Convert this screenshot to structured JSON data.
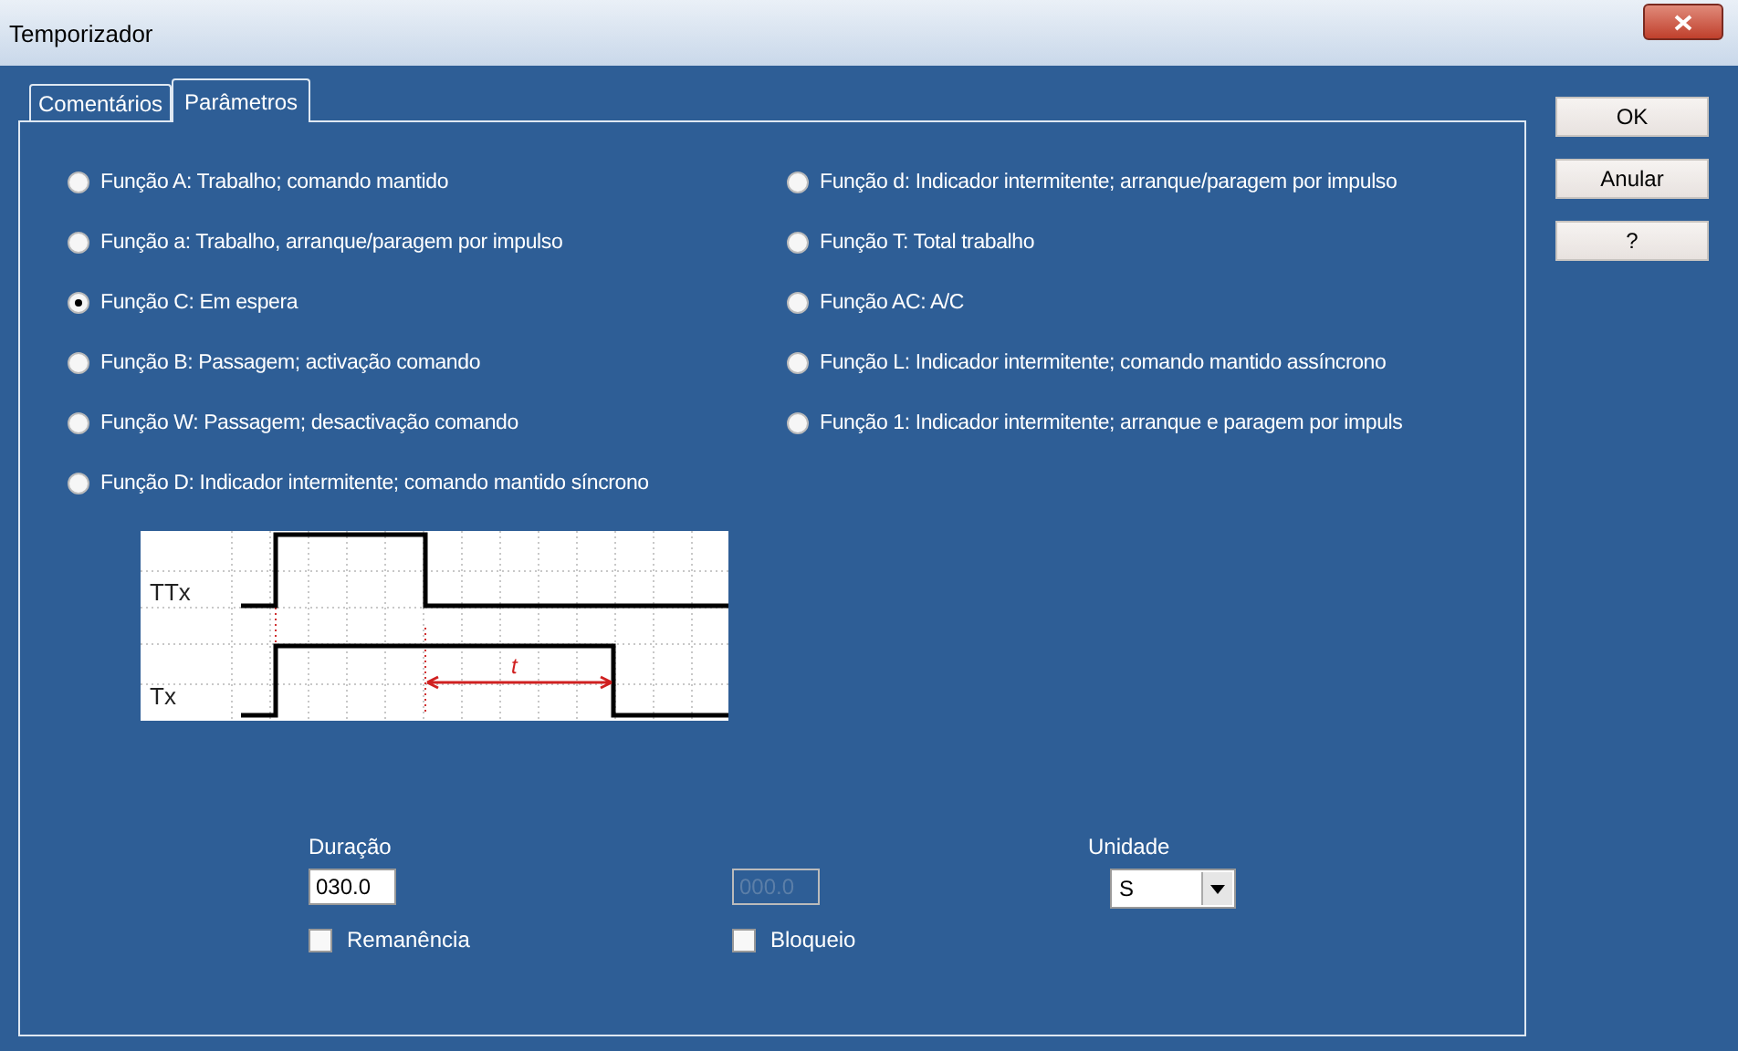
{
  "window": {
    "title": "Temporizador"
  },
  "tabs": [
    {
      "label": "Comentários",
      "selected": false
    },
    {
      "label": "Parâmetros",
      "selected": true
    }
  ],
  "functions": {
    "left": [
      {
        "label": "Função A: Trabalho; comando mantido",
        "selected": false
      },
      {
        "label": "Função a: Trabalho, arranque/paragem por impulso",
        "selected": false
      },
      {
        "label": "Função C: Em espera",
        "selected": true
      },
      {
        "label": "Função B: Passagem; activação comando",
        "selected": false
      },
      {
        "label": "Função W: Passagem; desactivação comando",
        "selected": false
      },
      {
        "label": "Função D: Indicador intermitente; comando mantido síncrono",
        "selected": false
      }
    ],
    "right": [
      {
        "label": "Função d: Indicador intermitente; arranque/paragem por impulso",
        "selected": false
      },
      {
        "label": "Função T: Total trabalho",
        "selected": false
      },
      {
        "label": "Função AC: A/C",
        "selected": false
      },
      {
        "label": "Função L: Indicador intermitente; comando mantido assíncrono",
        "selected": false
      },
      {
        "label": "Função 1: Indicador intermitente; arranque e paragem por impuls",
        "selected": false
      }
    ]
  },
  "timing_diagram": {
    "signals": [
      "TTx",
      "Tx"
    ],
    "interval_label": "t"
  },
  "duration": {
    "label": "Duração",
    "value": "030.0"
  },
  "second_field": {
    "value": "000.0",
    "disabled": true
  },
  "unit": {
    "label": "Unidade",
    "value": "S"
  },
  "checkboxes": [
    {
      "label": "Remanência",
      "checked": false
    },
    {
      "label": "Bloqueio",
      "checked": false
    }
  ],
  "buttons": [
    "OK",
    "Anular",
    "?"
  ]
}
